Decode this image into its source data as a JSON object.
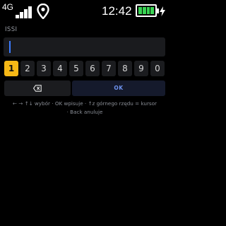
{
  "status_bar": {
    "network": "4G",
    "signal_bars": 4,
    "location_icon": "location-pin-icon",
    "time": "12:42",
    "battery_level_fraction": 1.0,
    "battery_charging": true,
    "battery_color": "#39d353"
  },
  "field": {
    "label": "ISSI",
    "value": "",
    "caret_color": "#3b7cff"
  },
  "keypad": {
    "digits": [
      "1",
      "2",
      "3",
      "4",
      "5",
      "6",
      "7",
      "8",
      "9",
      "0"
    ],
    "selected_digit": "1",
    "selected_color": "#f6b816",
    "backspace_icon": "backspace-icon",
    "ok_label": "OK",
    "ok_color": "#6e93f0"
  },
  "help": {
    "line1": "← → ↑↓ wybór · OK wpisuje · ↑z górnego rzędu = kursor",
    "line2": "· Back anuluje"
  }
}
